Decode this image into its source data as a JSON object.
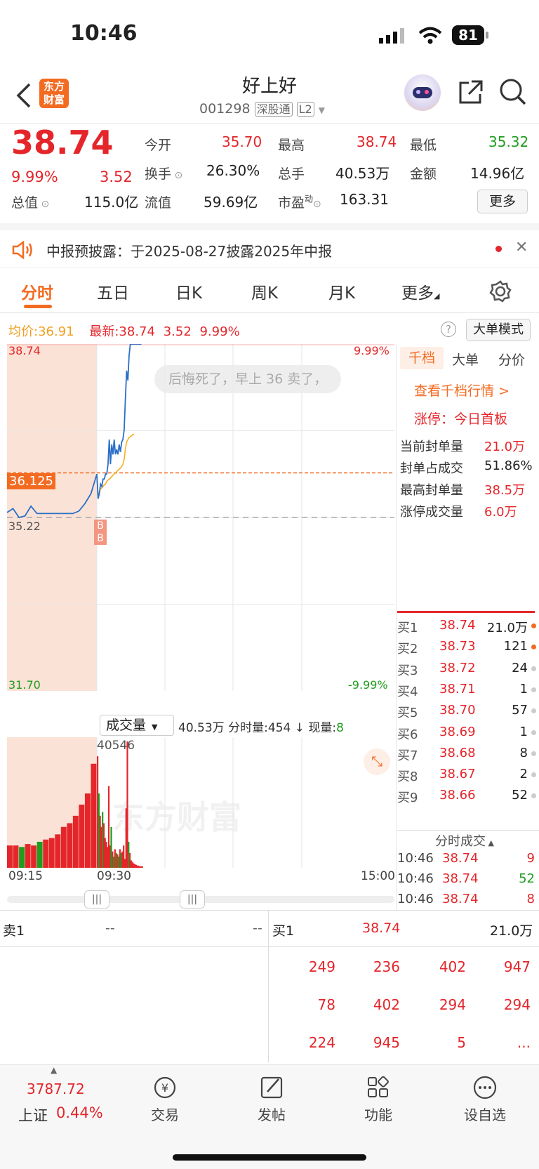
{
  "status_bar": {
    "time": "10:46",
    "battery": "81"
  },
  "header": {
    "title": "好上好",
    "code": "001298",
    "tag1": "深股通",
    "tag2": "L2",
    "logo_text": "东方财富"
  },
  "quote": {
    "price": "38.74",
    "pct": "9.99%",
    "chg": "3.52",
    "open_label": "今开",
    "open": "35.70",
    "high_label": "最高",
    "high": "38.74",
    "low_label": "最低",
    "low": "35.32",
    "turnover_label": "换手",
    "turnover": "26.30%",
    "vol_label": "总手",
    "vol": "40.53万",
    "amount_label": "金额",
    "amount": "14.96亿",
    "mktcap_label": "总值",
    "mktcap": "115.0亿",
    "float_label": "流值",
    "float": "59.69亿",
    "pe_label": "市盈",
    "pe_sup": "动",
    "pe": "163.31",
    "more_btn": "更多"
  },
  "notice": {
    "text": "中报预披露：于2025-08-27披露2025年中报"
  },
  "tabs": [
    "分时",
    "五日",
    "日K",
    "周K",
    "月K",
    "更多"
  ],
  "chart_info": {
    "avg_label": "均价:",
    "avg": "36.91",
    "latest_label": "最新:",
    "latest": "38.74",
    "chg": "3.52",
    "pct": "9.99%",
    "big_order_btn": "大单模式"
  },
  "chart": {
    "y_top": "38.74",
    "y_bottom": "31.70",
    "pct_top": "9.99%",
    "pct_bottom": "-9.99%",
    "cursor_price": "36.125",
    "prev_close": "35.22",
    "bubble": "后悔死了，早上 36 卖了，",
    "watermark": "东方财富",
    "marker": "B"
  },
  "volume": {
    "dropdown": "成交量",
    "summary_total": "40.53万",
    "summary_mins_label": "分时量:",
    "summary_mins": "454",
    "arrow": "↓",
    "summary_now_label": "现量:",
    "summary_now": "8",
    "max_label": "40546",
    "times": [
      "09:15",
      "09:30",
      "15:00"
    ]
  },
  "chart_data": {
    "type": "line",
    "x": [
      "09:15",
      "09:16",
      "09:17",
      "09:18",
      "09:19",
      "09:20",
      "09:21",
      "09:22",
      "09:23",
      "09:24",
      "09:25",
      "09:26",
      "09:27",
      "09:28",
      "09:29",
      "09:30",
      "09:31",
      "09:32",
      "09:33",
      "09:34",
      "09:35",
      "09:36",
      "09:37",
      "09:38",
      "09:39",
      "09:40",
      "09:41",
      "09:42",
      "09:43",
      "09:44",
      "09:45",
      "09:46",
      "09:47",
      "09:48",
      "09:49",
      "09:50",
      "09:51",
      "09:52",
      "09:53",
      "09:54",
      "09:55",
      "09:56",
      "09:57",
      "09:58",
      "09:59",
      "10:00",
      "10:01",
      "10:02",
      "10:03",
      "10:04",
      "10:05",
      "10:06"
    ],
    "series": [
      {
        "values": [
          35.32,
          35.4,
          35.22,
          35.25,
          35.45,
          35.3,
          35.3,
          35.3,
          35.3,
          35.3,
          35.3,
          35.3,
          35.35,
          35.5,
          35.7,
          36.1,
          35.6,
          35.7,
          35.9,
          35.85,
          36.0,
          36.0,
          36.1,
          36.1,
          36.3,
          36.8,
          36.3,
          36.7,
          36.5,
          36.8,
          36.5,
          36.6,
          36.5,
          36.7,
          36.55,
          36.75,
          36.8,
          37.0,
          37.6,
          38.2,
          38.0,
          38.5,
          38.74,
          38.74,
          38.74,
          38.74,
          38.74,
          38.74,
          38.74,
          38.74,
          38.74,
          38.74
        ]
      },
      {
        "values": [
          null,
          null,
          null,
          null,
          null,
          null,
          null,
          null,
          null,
          null,
          null,
          null,
          null,
          null,
          null,
          35.7,
          35.7,
          35.75,
          35.8,
          35.82,
          35.85,
          35.88,
          35.9,
          35.95,
          35.98,
          36.0,
          36.02,
          36.05,
          36.08,
          36.1,
          36.12,
          36.15,
          36.18,
          36.2,
          36.22,
          36.25,
          36.3,
          36.4,
          36.6,
          36.75,
          36.8,
          36.84,
          36.86,
          36.88,
          36.9,
          36.91,
          null,
          null,
          null,
          null,
          null,
          null
        ]
      }
    ],
    "ylim": [
      31.7,
      38.74
    ],
    "volume_mins": [
      30,
      30,
      28,
      32,
      30,
      35,
      38,
      40,
      45,
      55,
      60,
      70,
      85,
      100,
      140,
      150,
      100,
      70,
      55,
      75,
      60,
      40,
      35,
      28,
      110,
      30,
      55,
      22,
      15,
      25,
      20,
      18,
      15,
      25,
      20,
      22,
      30,
      12,
      80,
      170,
      35,
      20,
      10,
      8,
      6,
      5,
      4,
      3,
      3,
      2,
      2,
      2
    ]
  },
  "side_panel": {
    "tabs": [
      "千档",
      "大单",
      "分价"
    ],
    "link": "查看千档行情 >",
    "limit_label": "涨停：",
    "limit_value": "今日首板",
    "rows": [
      {
        "label": "当前封单量",
        "value": "21.0万"
      },
      {
        "label": "封单占成交",
        "value": "51.86%"
      },
      {
        "label": "最高封单量",
        "value": "38.5万"
      },
      {
        "label": "涨停成交量",
        "value": "6.0万"
      }
    ],
    "bids": [
      {
        "label": "买1",
        "price": "38.74",
        "qty": "21.0万"
      },
      {
        "label": "买2",
        "price": "38.73",
        "qty": "121"
      },
      {
        "label": "买3",
        "price": "38.72",
        "qty": "24"
      },
      {
        "label": "买4",
        "price": "38.71",
        "qty": "1"
      },
      {
        "label": "买5",
        "price": "38.70",
        "qty": "57"
      },
      {
        "label": "买6",
        "price": "38.69",
        "qty": "1"
      },
      {
        "label": "买7",
        "price": "38.68",
        "qty": "8"
      },
      {
        "label": "买8",
        "price": "38.67",
        "qty": "2"
      },
      {
        "label": "买9",
        "price": "38.66",
        "qty": "52"
      }
    ],
    "ticks_header": "分时成交",
    "ticks": [
      {
        "time": "10:46",
        "price": "38.74",
        "qty": "9"
      },
      {
        "time": "10:46",
        "price": "38.74",
        "qty": "52"
      },
      {
        "time": "10:46",
        "price": "38.74",
        "qty": "8"
      }
    ]
  },
  "queue": {
    "sell_label": "卖1",
    "sell_price": "--",
    "sell_qty": "--",
    "buy_label": "买1",
    "buy_price": "38.74",
    "buy_qty": "21.0万",
    "rows": [
      [
        "249",
        "236",
        "402",
        "947"
      ],
      [
        "78",
        "402",
        "294",
        "294"
      ],
      [
        "224",
        "945",
        "5",
        "..."
      ]
    ]
  },
  "dock": {
    "index_value": "3787.72",
    "index_name": "上证",
    "index_pct": "0.44%",
    "items": [
      "交易",
      "发帖",
      "功能",
      "设自选"
    ]
  }
}
